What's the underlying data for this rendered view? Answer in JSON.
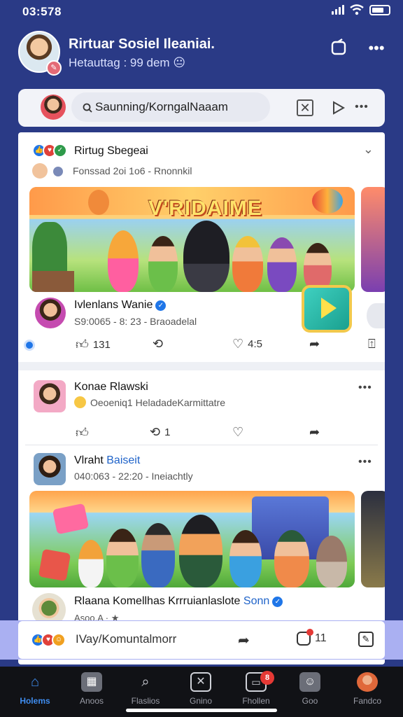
{
  "status_bar": {
    "time": "03:578"
  },
  "header": {
    "title": "Rirtuar Sosiel Ileaniai.",
    "subtitle": "Hetauttag : 99 dem",
    "subtitle_emoji": "😐"
  },
  "search": {
    "placeholder": "Saunning/KorngalNaaam"
  },
  "posts": [
    {
      "author": "Rirtug Sbegeai",
      "meta": "Fonssad 2oi 1o6 - Rnonnkil",
      "image_title": "V'RIDAIME",
      "sub_name": "Ivlenlans Wanie",
      "sub_meta": "S9:0065 - 8: 23 - Braoadelal",
      "actions": {
        "like_count": "131",
        "comment_count": "",
        "heart_count": "4:5"
      }
    },
    {
      "author": "Konae Rlawski",
      "meta": "Oeoeniq1 HeladadeKarmittatre",
      "actions": {
        "share_count": "1"
      }
    },
    {
      "author_prefix": "Vlraht ",
      "author_highlight": "Baiseit",
      "meta": "040:063 - 22:20 - Ineiachtly",
      "sub_name": "Rlaana Komellhas Krrruianlaslote",
      "sub_name_highlight": "Sonn",
      "sub_meta": "Asoo.A · ★"
    }
  ],
  "comment_bar": {
    "placeholder": "IVay/Komuntalmorr",
    "count": "11"
  },
  "bottom_nav": [
    {
      "label": "Holems",
      "icon": "home-icon",
      "active": true
    },
    {
      "label": "Anoos",
      "icon": "store-icon",
      "active": false
    },
    {
      "label": "Flaslios",
      "icon": "search-icon",
      "active": false
    },
    {
      "label": "Gnino",
      "icon": "compass-icon",
      "active": false
    },
    {
      "label": "Fhollen",
      "icon": "messages-icon",
      "active": false,
      "badge": "8"
    },
    {
      "label": "Goo",
      "icon": "gaming-icon",
      "active": false
    },
    {
      "label": "Fandco",
      "icon": "profile-icon",
      "active": false
    }
  ],
  "colors": {
    "background": "#2a3a86",
    "accent": "#3f8df0",
    "verified": "#1f76e8",
    "badge": "#e53935"
  }
}
